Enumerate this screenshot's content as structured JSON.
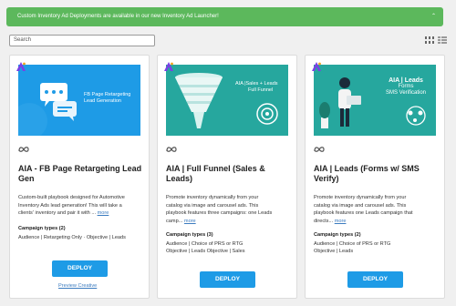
{
  "banner": {
    "text": "Custom Inventory Ad Deployments are available in our new Inventory Ad Launcher!",
    "caret": "⌃"
  },
  "search": {
    "placeholder": "Search"
  },
  "cards": [
    {
      "hero_lines": [
        "FB Page Retargeting",
        "Lead Generation"
      ],
      "title_lines": [
        "AIA - FB Page Retargeting Lead",
        "Gen"
      ],
      "desc_lines": [
        "Custom-built playbook designed for Automotive",
        "Inventory Ads lead generation! This will take a",
        "clients' inventory and pair it with ... "
      ],
      "more": "more",
      "campaign_types_label": "Campaign types (2)",
      "type_lines": [
        "Audience | Retargeting Only   ·   Objective | Leads"
      ],
      "deploy_label": "DEPLOY",
      "preview_label": "Preview Creative"
    },
    {
      "hero_lines": [
        "AIA |Sales + Leads",
        "Full Funnel"
      ],
      "title_lines": [
        "AIA | Full Funnel (Sales &",
        "Leads)"
      ],
      "desc_lines": [
        "Promote inventory dynamically from your",
        "catalog via image and carousel ads. This",
        "playbook features three campaigns: one Leads",
        "camp... "
      ],
      "more": "more",
      "campaign_types_label": "Campaign types (3)",
      "type_lines": [
        "Audience | Choice of PRS or RTG",
        "Objective | Leads     Objective | Sales"
      ],
      "deploy_label": "DEPLOY"
    },
    {
      "hero_lines": [
        "AIA | Leads",
        "Forms",
        "SMS Verification"
      ],
      "title_lines": [
        "AIA | Leads (Forms w/ SMS",
        "Verify)"
      ],
      "desc_lines": [
        "Promote inventory dynamically from your",
        "catalog via image and carousel ads. This",
        "playbook features one Leads campaign that",
        "directs... "
      ],
      "more": "more",
      "campaign_types_label": "Campaign types (2)",
      "type_lines": [
        "Audience | Choice of PRS or RTG",
        "Objective | Leads"
      ],
      "deploy_label": "DEPLOY"
    }
  ],
  "colors": {
    "banner": "#5cb85c",
    "deploy": "#1e9be6",
    "hero_blue": "#1e9be6",
    "hero_teal": "#26a79e",
    "link": "#3b7bbf",
    "brand_purple": "#7b3fe4"
  }
}
